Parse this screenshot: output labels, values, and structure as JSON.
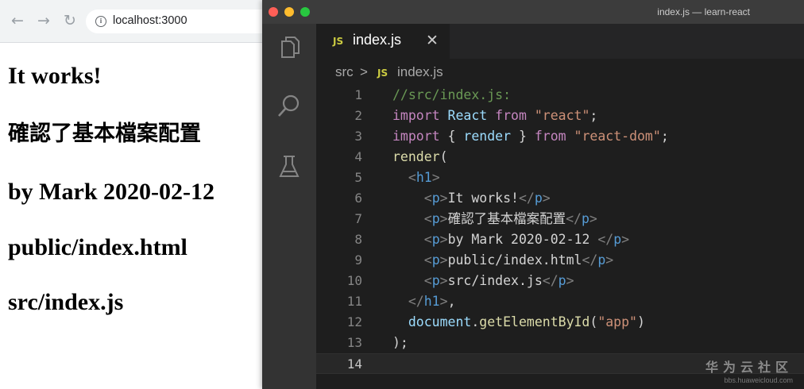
{
  "browser": {
    "url": "localhost:3000",
    "page_lines": [
      "It works!",
      "確認了基本檔案配置",
      "by Mark 2020-02-12",
      "public/index.html",
      "src/index.js"
    ]
  },
  "vscode": {
    "window_title": "index.js — learn-react",
    "tab": {
      "badge": "JS",
      "label": "index.js"
    },
    "breadcrumb": {
      "folder": "src",
      "separator": ">",
      "badge": "JS",
      "file": "index.js"
    },
    "code_lines": [
      {
        "n": "1",
        "tokens": [
          {
            "t": "//src/index.js:",
            "c": "#6a9955"
          }
        ]
      },
      {
        "n": "2",
        "tokens": [
          {
            "t": "import",
            "c": "#c586c0"
          },
          {
            "t": " "
          },
          {
            "t": "React",
            "c": "#9cdcfe"
          },
          {
            "t": " "
          },
          {
            "t": "from",
            "c": "#c586c0"
          },
          {
            "t": " "
          },
          {
            "t": "\"react\"",
            "c": "#ce9178"
          },
          {
            "t": ";"
          }
        ]
      },
      {
        "n": "3",
        "tokens": [
          {
            "t": "import",
            "c": "#c586c0"
          },
          {
            "t": " { "
          },
          {
            "t": "render",
            "c": "#9cdcfe"
          },
          {
            "t": " } "
          },
          {
            "t": "from",
            "c": "#c586c0"
          },
          {
            "t": " "
          },
          {
            "t": "\"react-dom\"",
            "c": "#ce9178"
          },
          {
            "t": ";"
          }
        ]
      },
      {
        "n": "4",
        "tokens": [
          {
            "t": "render",
            "c": "#dcdcaa"
          },
          {
            "t": "("
          }
        ]
      },
      {
        "n": "5",
        "tokens": [
          {
            "t": "  "
          },
          {
            "t": "<",
            "c": "#808080"
          },
          {
            "t": "h1",
            "c": "#569cd6"
          },
          {
            "t": ">",
            "c": "#808080"
          }
        ]
      },
      {
        "n": "6",
        "tokens": [
          {
            "t": "    "
          },
          {
            "t": "<",
            "c": "#808080"
          },
          {
            "t": "p",
            "c": "#569cd6"
          },
          {
            "t": ">",
            "c": "#808080"
          },
          {
            "t": "It works!"
          },
          {
            "t": "</",
            "c": "#808080"
          },
          {
            "t": "p",
            "c": "#569cd6"
          },
          {
            "t": ">",
            "c": "#808080"
          }
        ]
      },
      {
        "n": "7",
        "tokens": [
          {
            "t": "    "
          },
          {
            "t": "<",
            "c": "#808080"
          },
          {
            "t": "p",
            "c": "#569cd6"
          },
          {
            "t": ">",
            "c": "#808080"
          },
          {
            "t": "確認了基本檔案配置"
          },
          {
            "t": "</",
            "c": "#808080"
          },
          {
            "t": "p",
            "c": "#569cd6"
          },
          {
            "t": ">",
            "c": "#808080"
          }
        ]
      },
      {
        "n": "8",
        "tokens": [
          {
            "t": "    "
          },
          {
            "t": "<",
            "c": "#808080"
          },
          {
            "t": "p",
            "c": "#569cd6"
          },
          {
            "t": ">",
            "c": "#808080"
          },
          {
            "t": "by Mark 2020-02-12 "
          },
          {
            "t": "</",
            "c": "#808080"
          },
          {
            "t": "p",
            "c": "#569cd6"
          },
          {
            "t": ">",
            "c": "#808080"
          }
        ]
      },
      {
        "n": "9",
        "tokens": [
          {
            "t": "    "
          },
          {
            "t": "<",
            "c": "#808080"
          },
          {
            "t": "p",
            "c": "#569cd6"
          },
          {
            "t": ">",
            "c": "#808080"
          },
          {
            "t": "public/index.html"
          },
          {
            "t": "</",
            "c": "#808080"
          },
          {
            "t": "p",
            "c": "#569cd6"
          },
          {
            "t": ">",
            "c": "#808080"
          }
        ]
      },
      {
        "n": "10",
        "tokens": [
          {
            "t": "    "
          },
          {
            "t": "<",
            "c": "#808080"
          },
          {
            "t": "p",
            "c": "#569cd6"
          },
          {
            "t": ">",
            "c": "#808080"
          },
          {
            "t": "src/index.js"
          },
          {
            "t": "</",
            "c": "#808080"
          },
          {
            "t": "p",
            "c": "#569cd6"
          },
          {
            "t": ">",
            "c": "#808080"
          }
        ]
      },
      {
        "n": "11",
        "tokens": [
          {
            "t": "  "
          },
          {
            "t": "</",
            "c": "#808080"
          },
          {
            "t": "h1",
            "c": "#569cd6"
          },
          {
            "t": ">",
            "c": "#808080"
          },
          {
            "t": ","
          }
        ]
      },
      {
        "n": "12",
        "tokens": [
          {
            "t": "  "
          },
          {
            "t": "document",
            "c": "#9cdcfe"
          },
          {
            "t": "."
          },
          {
            "t": "getElementById",
            "c": "#dcdcaa"
          },
          {
            "t": "("
          },
          {
            "t": "\"app\"",
            "c": "#ce9178"
          },
          {
            "t": ")"
          }
        ]
      },
      {
        "n": "13",
        "tokens": [
          {
            "t": ");"
          }
        ]
      },
      {
        "n": "14",
        "tokens": [],
        "current": true
      }
    ]
  },
  "watermark": {
    "main": "华为云社区",
    "sub": "bbs.huaweicloud.com"
  }
}
